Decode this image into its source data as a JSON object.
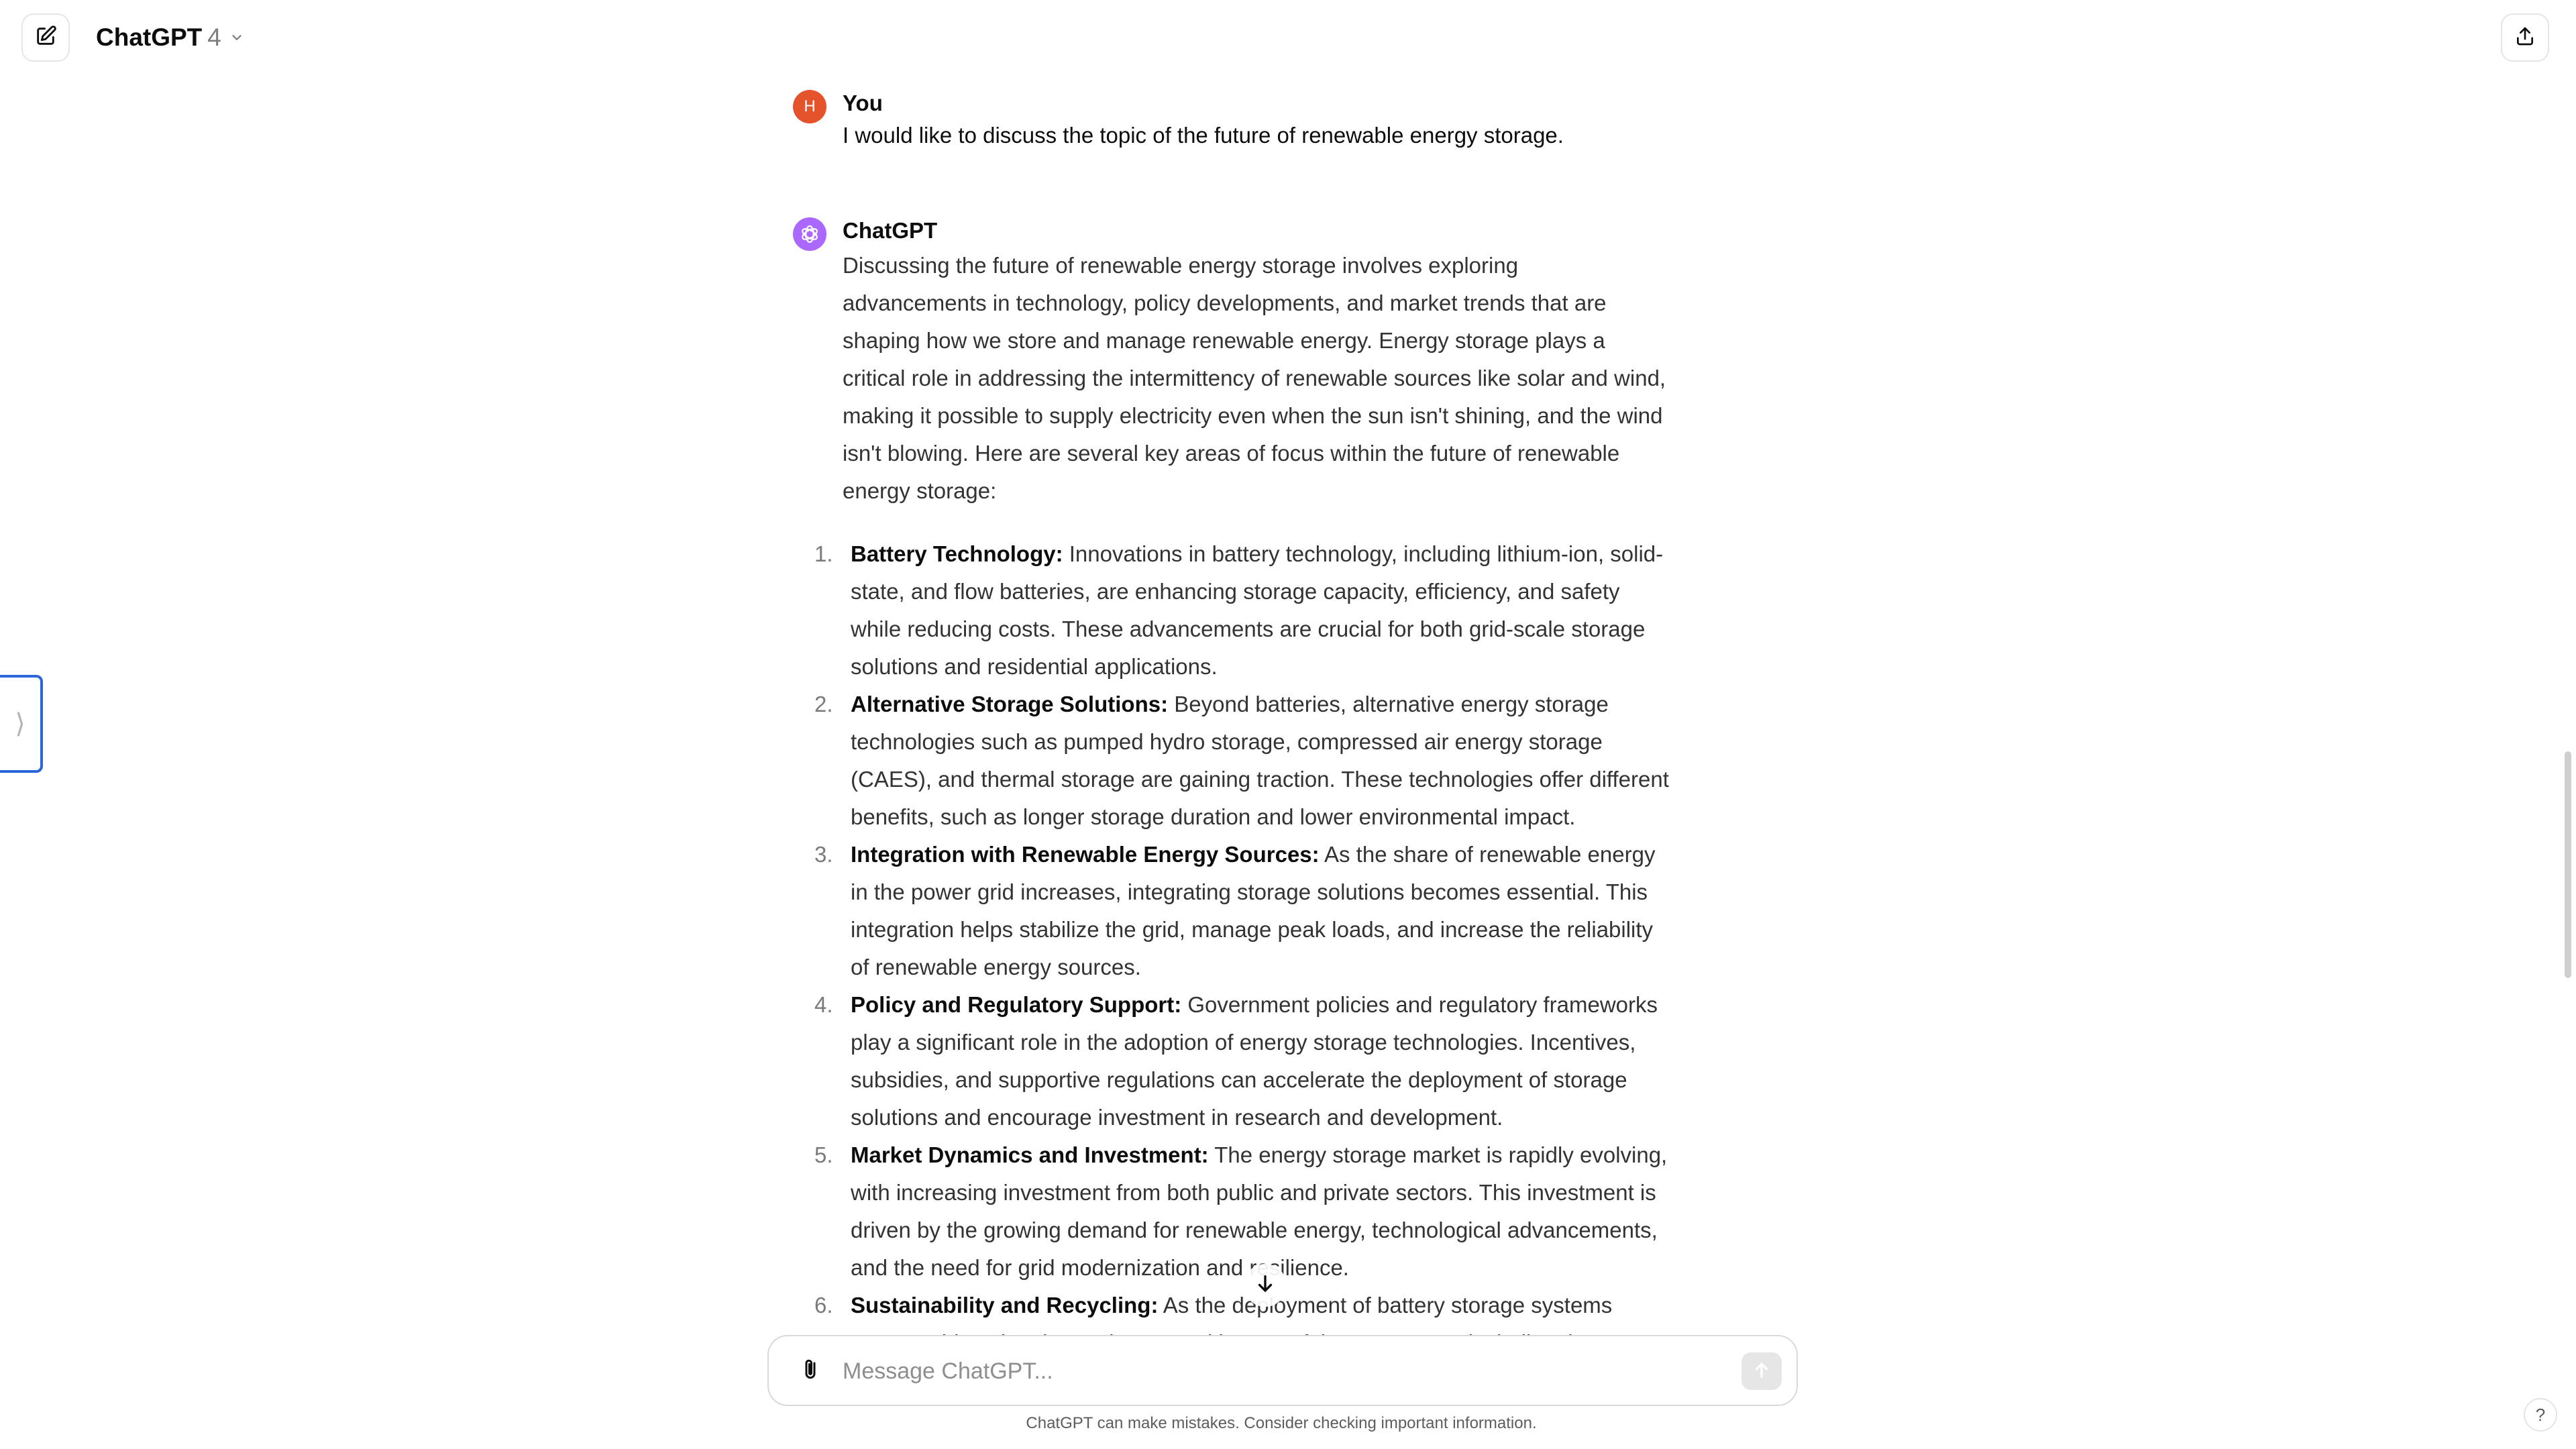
{
  "header": {
    "model_name": "ChatGPT",
    "model_version": "4"
  },
  "conversation": {
    "user_message": {
      "avatar_initial": "H",
      "author": "You",
      "text": "I would like to discuss the topic of the future of renewable energy storage."
    },
    "assistant_message": {
      "author": "ChatGPT",
      "intro": "Discussing the future of renewable energy storage involves exploring advancements in technology, policy developments, and market trends that are shaping how we store and manage renewable energy. Energy storage plays a critical role in addressing the intermittency of renewable sources like solar and wind, making it possible to supply electricity even when the sun isn't shining, and the wind isn't blowing. Here are several key areas of focus within the future of renewable energy storage:",
      "items": [
        {
          "number": "1.",
          "term": "Battery Technology:",
          "text": " Innovations in battery technology, including lithium-ion, solid-state, and flow batteries, are enhancing storage capacity, efficiency, and safety while reducing costs. These advancements are crucial for both grid-scale storage solutions and residential applications."
        },
        {
          "number": "2.",
          "term": "Alternative Storage Solutions:",
          "text": " Beyond batteries, alternative energy storage technologies such as pumped hydro storage, compressed air energy storage (CAES), and thermal storage are gaining traction. These technologies offer different benefits, such as longer storage duration and lower environmental impact."
        },
        {
          "number": "3.",
          "term": "Integration with Renewable Energy Sources:",
          "text": " As the share of renewable energy in the power grid increases, integrating storage solutions becomes essential. This integration helps stabilize the grid, manage peak loads, and increase the reliability of renewable energy sources."
        },
        {
          "number": "4.",
          "term": "Policy and Regulatory Support:",
          "text": " Government policies and regulatory frameworks play a significant role in the adoption of energy storage technologies. Incentives, subsidies, and supportive regulations can accelerate the deployment of storage solutions and encourage investment in research and development."
        },
        {
          "number": "5.",
          "term": "Market Dynamics and Investment:",
          "text": " The energy storage market is rapidly evolving, with increasing investment from both public and private sectors. This investment is driven by the growing demand for renewable energy, technological advancements, and the need for grid modernization and resilience."
        },
        {
          "number": "6.",
          "term": "Sustainability and Recycling:",
          "text": " As the deployment of battery storage systems grows, addressing the environmental impact of these systems, including the sourcing of"
        }
      ]
    }
  },
  "composer": {
    "placeholder": "Message ChatGPT..."
  },
  "footer": {
    "disclaimer": "ChatGPT can make mistakes. Consider checking important information.",
    "help_label": "?"
  },
  "sidebar_toggle": {
    "glyph": "⟩"
  },
  "colors": {
    "user_avatar": "#e5532d",
    "assistant_avatar": "#ab68ff",
    "toggle_outline": "#2a66d9"
  },
  "icons": {
    "new_chat": "pencil-square-icon",
    "model_dropdown": "chevron-down-icon",
    "share": "share-upload-icon",
    "assistant_avatar": "openai-logo-icon",
    "scroll_down": "arrow-down-icon",
    "attach": "paperclip-icon",
    "send": "arrow-up-icon"
  }
}
